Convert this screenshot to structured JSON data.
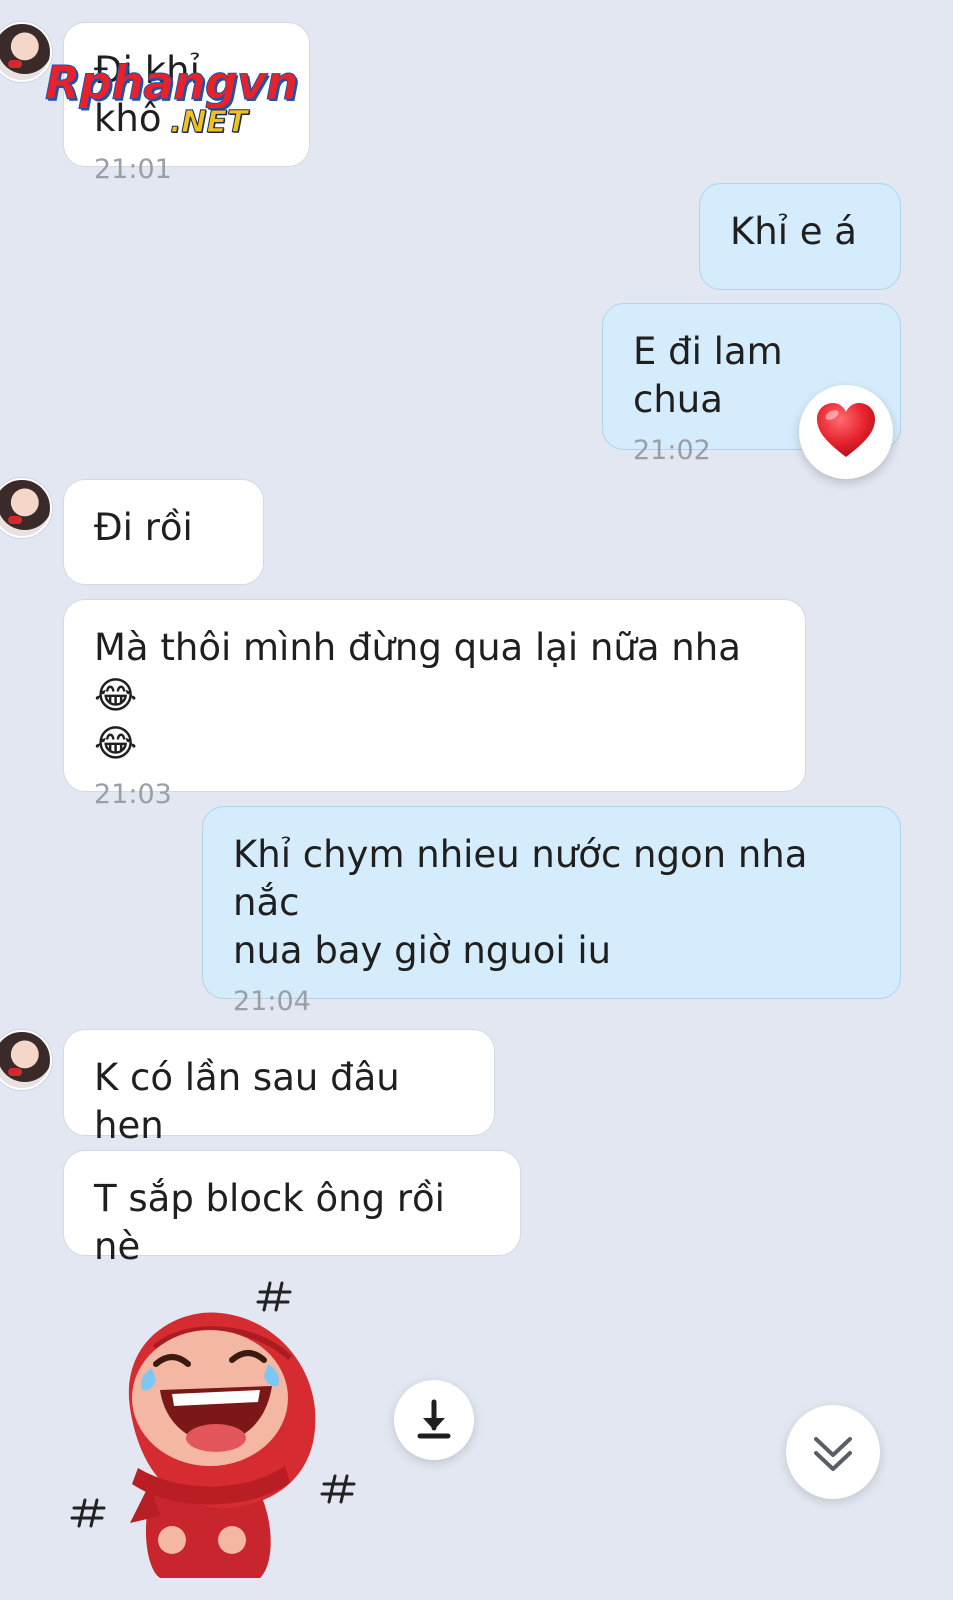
{
  "watermark": {
    "main_text": "Rphangvn",
    "sub_text": ".NET"
  },
  "messages": [
    {
      "id": "m1",
      "side": "received",
      "text": "Đi khỉ khô",
      "time": "21:01"
    },
    {
      "id": "m2",
      "side": "sent",
      "text": "Khỉ e á",
      "time": ""
    },
    {
      "id": "m3",
      "side": "sent",
      "text": "E đi lam chua",
      "time": "21:02",
      "reaction": "heart"
    },
    {
      "id": "m4",
      "side": "received",
      "text": "Đi rồi",
      "time": ""
    },
    {
      "id": "m5",
      "side": "received",
      "text": "Mà thôi mình đừng qua lại nữa nha 😂\n😂",
      "time": "21:03"
    },
    {
      "id": "m6",
      "side": "sent",
      "text": "Khỉ chym nhieu nước ngon nha nắc\nnua bay giờ nguoi iu",
      "time": "21:04"
    },
    {
      "id": "m7",
      "side": "received",
      "text": "K có lần sau đâu hen",
      "time": ""
    },
    {
      "id": "m8",
      "side": "received",
      "text": "T sắp block ông rồi nè",
      "time": ""
    }
  ],
  "sticker": {
    "icon": "laughing-red-hood-sticker"
  },
  "controls": {
    "download_icon": "download-icon",
    "scroll_down_icon": "double-chevron-down-icon"
  },
  "colors": {
    "background": "#e2e7f1",
    "received_bubble": "#ffffff",
    "sent_bubble": "#d4ecfb",
    "heart": "#e8242f"
  }
}
